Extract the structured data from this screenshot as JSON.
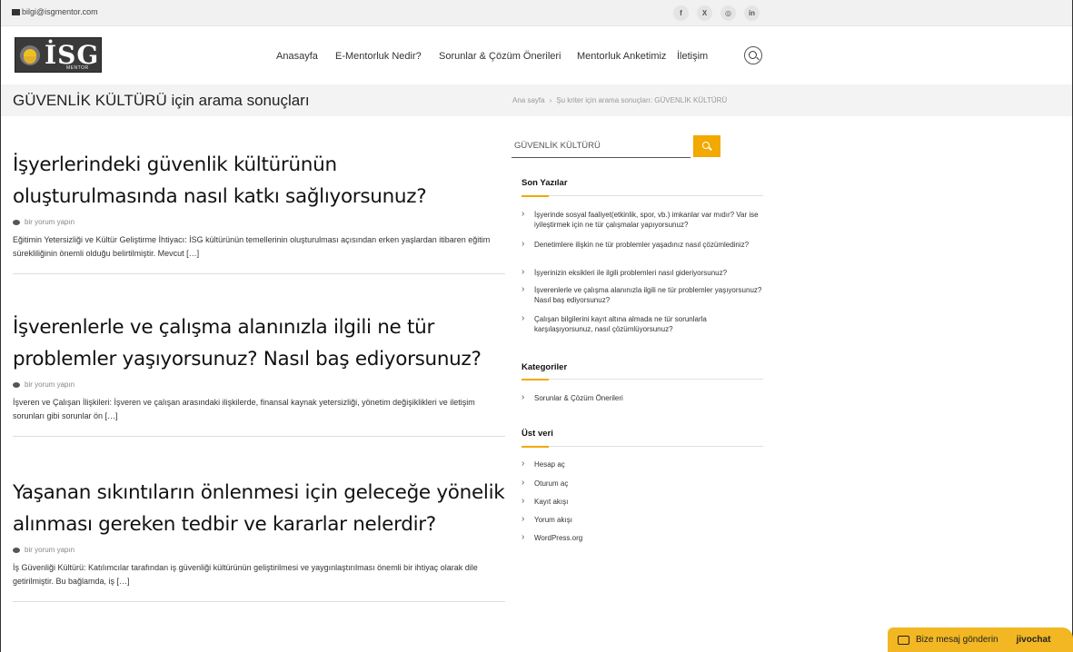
{
  "topbar": {
    "email": "bilgi@isgmentor.com",
    "social": [
      "f",
      "X",
      "◎",
      "in"
    ]
  },
  "logo": {
    "text": "İSG",
    "subtitle": "MENTOR"
  },
  "nav": {
    "items": [
      "Anasayfa",
      "E-Mentorluk Nedir?",
      "Sorunlar & Çözüm Önerileri",
      "Mentorluk Anketimiz",
      "İletişim"
    ]
  },
  "page_header": {
    "title": "GÜVENLİK KÜLTÜRÜ için arama sonuçları",
    "breadcrumb_home": "Ana sayfa",
    "breadcrumb_separator": "›",
    "breadcrumb_current": "Şu kriter için arama sonuçları: GÜVENLİK KÜLTÜRÜ"
  },
  "posts": [
    {
      "title": "İşyerlerindeki güvenlik kültürünün oluşturulmasında nasıl katkı sağlıyorsunuz?",
      "meta": "bir yorum yapın",
      "excerpt": "Eğitimin Yetersizliği ve Kültür Geliştirme İhtiyacı: İSG kültürünün temellerinin oluşturulması açısından erken yaşlardan itibaren eğitim sürekliliğinin önemli olduğu belirtilmiştir. Mevcut […]"
    },
    {
      "title": "İşverenlerle ve çalışma alanınızla ilgili ne tür problemler yaşıyorsunuz? Nasıl baş ediyorsunuz?",
      "meta": "bir yorum yapın",
      "excerpt": "İşveren ve Çalışan İlişkileri: İşveren ve çalışan arasındaki ilişkilerde, finansal kaynak yetersizliği, yönetim değişiklikleri ve iletişim sorunları gibi sorunlar ön […]"
    },
    {
      "title": "Yaşanan sıkıntıların önlenmesi için geleceğe yönelik alınması gereken tedbir ve kararlar nelerdir?",
      "meta": "bir yorum yapın",
      "excerpt": "İş Güvenliği Kültürü: Katılımcılar tarafından iş güvenliği kültürünün geliştirilmesi ve yaygınlaştırılması önemli bir ihtiyaç olarak dile getirilmiştir. Bu bağlamda, iş […]"
    }
  ],
  "sidebar": {
    "search_value": "GÜVENLİK KÜLTÜRÜ",
    "recent_title": "Son Yazılar",
    "recent": [
      "İşyerinde sosyal faaliyet(etkinlik, spor, vb.) imkanlar var mıdır? Var ise iyileştirmek için ne tür çalışmalar yapıyorsunuz?",
      "Denetimlere ilişkin ne tür problemler yaşadınız nasıl çözümlediniz?",
      "İşyerinizin eksikleri ile ilgili problemleri nasıl gideriyorsunuz?",
      "İşverenlerle ve çalışma alanınızla ilgili ne tür problemler yaşıyorsunuz? Nasıl baş ediyorsunuz?",
      "Çalışan bilgilerini kayıt altına almada ne tür sorunlarla karşılaşıyorsunuz, nasıl çözümlüyorsunuz?"
    ],
    "categories_title": "Kategoriler",
    "categories": [
      "Sorunlar & Çözüm Önerileri"
    ],
    "meta_title": "Üst veri",
    "meta": [
      "Hesap aç",
      "Oturum aç",
      "Kayıt akışı",
      "Yorum akışı",
      "WordPress.org"
    ]
  },
  "chat": {
    "label": "Bize mesaj gönderin",
    "brand": "jivochat"
  },
  "colors": {
    "accent": "#f2a900",
    "chat": "#f2b722"
  }
}
